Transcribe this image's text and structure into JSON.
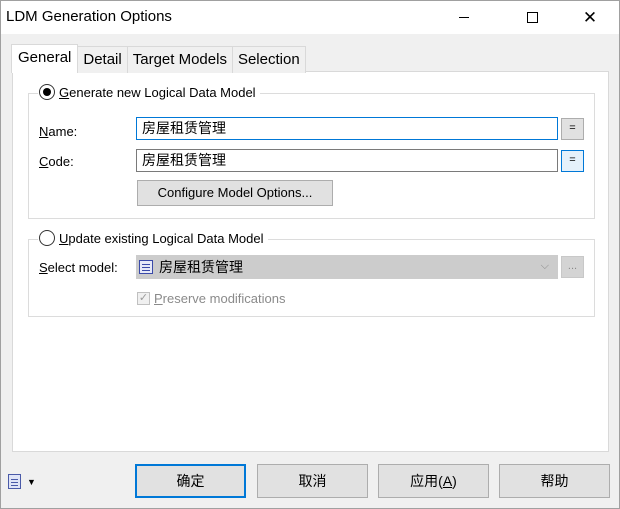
{
  "window": {
    "title": "LDM Generation Options",
    "minimize_icon": "minimize-icon",
    "maximize_icon": "maximize-icon",
    "close_icon": "close-icon",
    "close_glyph": "✕"
  },
  "tabs": [
    {
      "label": "General",
      "active": true
    },
    {
      "label": "Detail",
      "active": false
    },
    {
      "label": "Target Models",
      "active": false
    },
    {
      "label": "Selection",
      "active": false
    }
  ],
  "generate_group": {
    "radio_label_first": "G",
    "radio_label_rest": "enerate new Logical Data Model",
    "selected": true,
    "name_label_first": "N",
    "name_label_rest": "ame:",
    "name_value": "房屋租赁管理",
    "code_label_first": "C",
    "code_label_rest": "ode:",
    "code_value": "房屋租赁管理",
    "equal_button": "=",
    "configure_button": "Configure Model Options..."
  },
  "update_group": {
    "radio_label_first": "U",
    "radio_label_rest": "pdate existing Logical Data Model",
    "selected": false,
    "select_model_label_first": "S",
    "select_model_label_rest": "elect model:",
    "select_model_value": "房屋租赁管理",
    "ellipsis_button": "...",
    "preserve_label_first": "P",
    "preserve_label_rest": "reserve modifications",
    "preserve_checked": true,
    "check_glyph": "✓",
    "chevron_glyph": "⌵"
  },
  "footer": {
    "ok": "确定",
    "cancel": "取消",
    "apply_prefix": "应用(",
    "apply_accel": "A",
    "apply_suffix": ")",
    "help": "帮助",
    "menu_icon": "document-menu-icon",
    "caret_glyph": "▼"
  }
}
